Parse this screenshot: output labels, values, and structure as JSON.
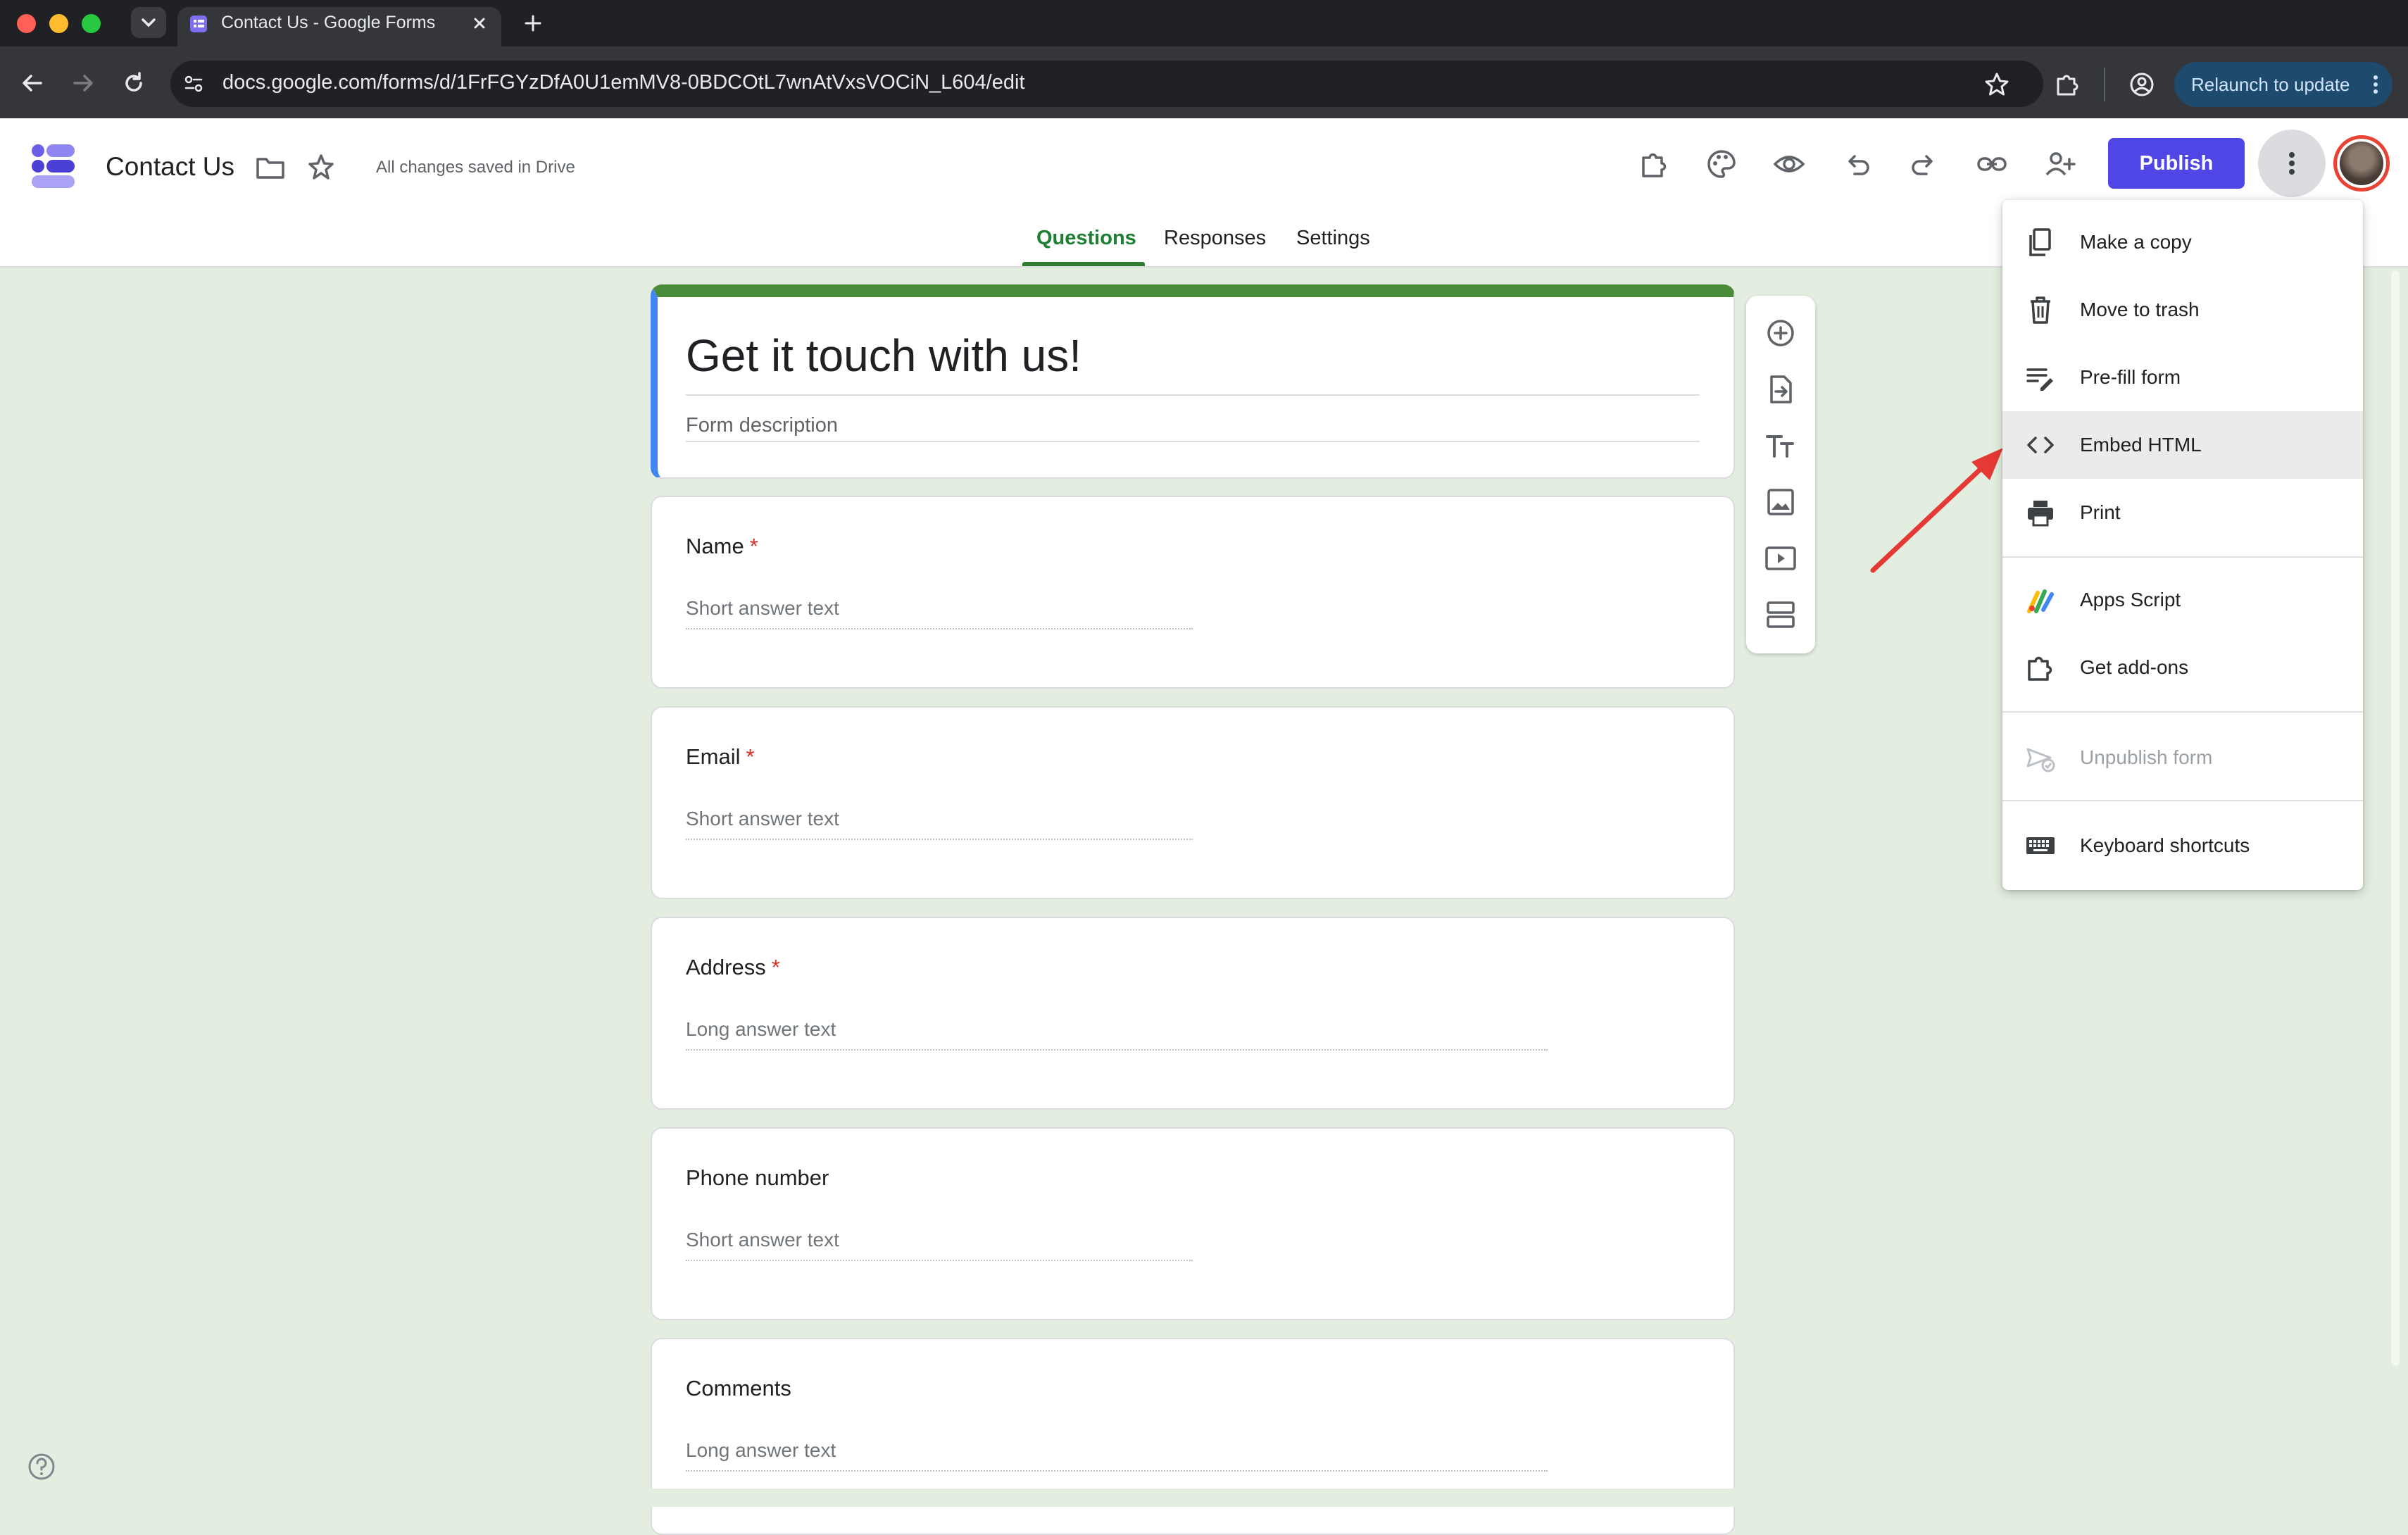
{
  "browser": {
    "tab_title": "Contact Us - Google Forms",
    "url": "docs.google.com/forms/d/1FrFGYzDfA0U1emMV8-0BDCOtL7wnAtVxsVOCiN_L604/edit",
    "relaunch_label": "Relaunch to update"
  },
  "app": {
    "form_name": "Contact Us",
    "save_status": "All changes saved in Drive",
    "publish_label": "Publish",
    "brand_color": "#4f46e5",
    "accent_color": "#2e7d32"
  },
  "tabs": [
    {
      "label": "Questions",
      "active": true
    },
    {
      "label": "Responses",
      "active": false
    },
    {
      "label": "Settings",
      "active": false
    }
  ],
  "form": {
    "title": "Get it touch with us!",
    "description_placeholder": "Form description",
    "questions": [
      {
        "label": "Name",
        "required": true,
        "answer_placeholder": "Short answer text"
      },
      {
        "label": "Email",
        "required": true,
        "answer_placeholder": "Short answer text"
      },
      {
        "label": "Address",
        "required": true,
        "answer_placeholder": "Long answer text"
      },
      {
        "label": "Phone number",
        "required": false,
        "answer_placeholder": "Short answer text"
      },
      {
        "label": "Comments",
        "required": false,
        "answer_placeholder": "Long answer text"
      }
    ],
    "required_mark": "*"
  },
  "menu": {
    "items": [
      {
        "label": "Make a copy",
        "icon": "copy-icon"
      },
      {
        "label": "Move to trash",
        "icon": "trash-icon"
      },
      {
        "label": "Pre-fill form",
        "icon": "prefill-icon"
      },
      {
        "label": "Embed HTML",
        "icon": "code-icon",
        "highlighted": true
      },
      {
        "label": "Print",
        "icon": "print-icon"
      },
      {
        "label": "Apps Script",
        "icon": "apps-script-icon"
      },
      {
        "label": "Get add-ons",
        "icon": "puzzle-icon"
      },
      {
        "label": "Unpublish form",
        "icon": "unpublish-icon",
        "disabled": true
      },
      {
        "label": "Keyboard shortcuts",
        "icon": "keyboard-icon"
      }
    ]
  }
}
